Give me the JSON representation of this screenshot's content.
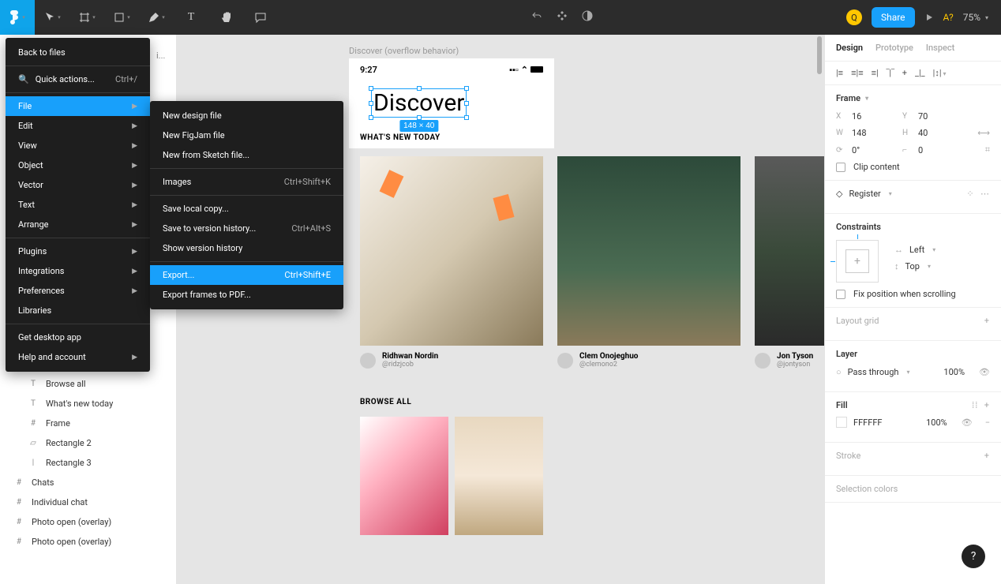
{
  "toolbar": {
    "avatar_initial": "Q",
    "share": "Share",
    "a_label": "A?",
    "zoom": "75%"
  },
  "menu1": {
    "back": "Back to files",
    "quick": "Quick actions...",
    "quick_sc": "Ctrl+/",
    "file": "File",
    "edit": "Edit",
    "view": "View",
    "object": "Object",
    "vector": "Vector",
    "text": "Text",
    "arrange": "Arrange",
    "plugins": "Plugins",
    "integrations": "Integrations",
    "preferences": "Preferences",
    "libraries": "Libraries",
    "desktop": "Get desktop app",
    "help": "Help and account"
  },
  "menu2": {
    "new_design": "New design file",
    "new_figjam": "New FigJam file",
    "new_sketch": "New from Sketch file...",
    "images": "Images",
    "images_sc": "Ctrl+Shift+K",
    "save_local": "Save local copy...",
    "save_version": "Save to version history...",
    "save_version_sc": "Ctrl+Alt+S",
    "show_version": "Show version history",
    "export": "Export...",
    "export_sc": "Ctrl+Shift+E",
    "export_pdf": "Export frames to PDF..."
  },
  "layers": {
    "browse_all": "Browse all",
    "whats_new": "What's new today",
    "frame": "Frame",
    "rect2": "Rectangle 2",
    "rect3": "Rectangle 3",
    "chats": "Chats",
    "indiv": "Individual chat",
    "photo1": "Photo open (overlay)",
    "photo2": "Photo open (overlay)",
    "breadcrumb": "i..."
  },
  "canvas": {
    "frame_label": "Discover (overflow behavior)",
    "time": "9:27",
    "title": "Discover",
    "selection_dim": "148 × 40",
    "whats_new": "WHAT'S NEW TODAY",
    "browse_all": "BROWSE ALL",
    "cards": [
      {
        "name": "Ridhwan Nordin",
        "handle": "@ridzjcob"
      },
      {
        "name": "Clem Onojeghuo",
        "handle": "@clemono2"
      },
      {
        "name": "Jon Tyson",
        "handle": "@jontyson"
      }
    ]
  },
  "right": {
    "tabs": {
      "design": "Design",
      "prototype": "Prototype",
      "inspect": "Inspect"
    },
    "frame_title": "Frame",
    "x": "16",
    "y": "70",
    "w": "148",
    "h": "40",
    "rot": "0°",
    "rad": "0",
    "clip": "Clip content",
    "register": "Register",
    "constraints": "Constraints",
    "c_left": "Left",
    "c_top": "Top",
    "fix": "Fix position when scrolling",
    "layout_grid": "Layout grid",
    "layer": "Layer",
    "pass": "Pass through",
    "pass_pct": "100%",
    "fill": "Fill",
    "fill_hex": "FFFFFF",
    "fill_pct": "100%",
    "stroke": "Stroke",
    "sel_colors": "Selection colors"
  },
  "help": "?"
}
